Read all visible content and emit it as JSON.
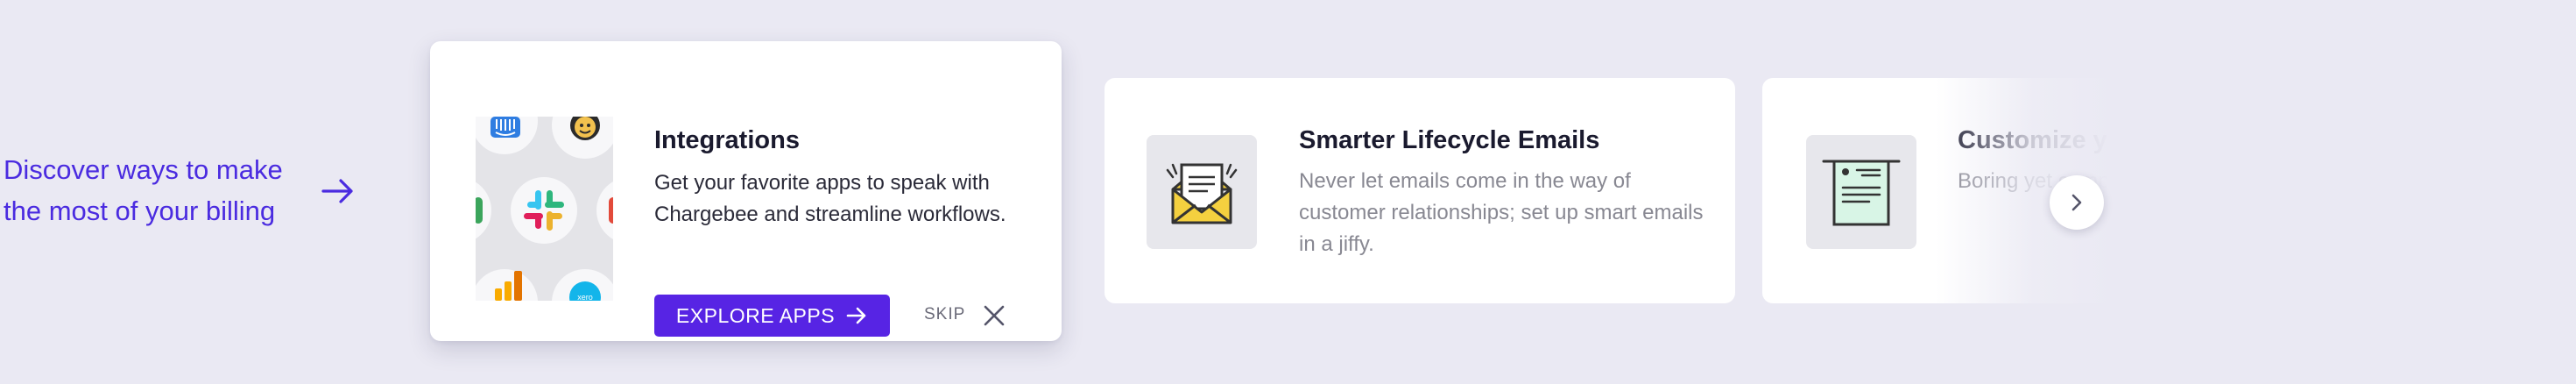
{
  "intro": {
    "text": "Discover ways to make the most of your billing",
    "arrow_icon": "arrow-right-icon"
  },
  "featured": {
    "title": "Integrations",
    "description": "Get your favorite apps to speak with Chargebee and streamline workflows.",
    "explore_label": "EXPLORE APPS",
    "skip_label": "SKIP",
    "close_icon": "close-icon",
    "art_icons": [
      "intercom-icon",
      "mailchimp-icon",
      "slack-icon",
      "google-analytics-icon",
      "xero-icon"
    ]
  },
  "cards": [
    {
      "title": "Smarter Lifecycle Emails",
      "description": "Never let emails come in the way of customer relationships; set up smart emails in a jiffy.",
      "icon": "envelope-icon"
    },
    {
      "title": "Customize your invoices",
      "description": "Boring yet comprehensive invoices that",
      "icon": "invoice-icon"
    }
  ],
  "carousel": {
    "next_icon": "chevron-right-icon"
  },
  "colors": {
    "accent": "#5724e4",
    "intro_text": "#4a2be0",
    "background": "#eae9f3"
  }
}
